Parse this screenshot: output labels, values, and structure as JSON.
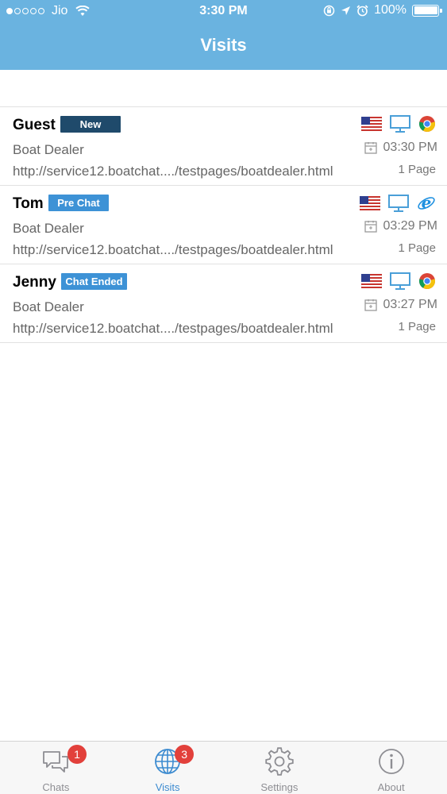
{
  "status_bar": {
    "carrier": "Jio",
    "time": "3:30 PM",
    "battery": "100%"
  },
  "header": {
    "title": "Visits"
  },
  "visits": [
    {
      "name": "Guest",
      "status": "New",
      "status_color": "#1f4a6b",
      "company": "Boat Dealer",
      "url": "http://service12.boatchat..../testpages/boatdealer.html",
      "time": "03:30 PM",
      "pages": "1 Page",
      "browser": "chrome-icon",
      "device": "desktop-icon",
      "flag": "us-flag-icon"
    },
    {
      "name": "Tom",
      "status": "Pre Chat",
      "status_color": "#3d92d6",
      "company": "Boat Dealer",
      "url": "http://service12.boatchat..../testpages/boatdealer.html",
      "time": "03:29 PM",
      "pages": "1 Page",
      "browser": "ie-icon",
      "device": "desktop-icon",
      "flag": "us-flag-icon"
    },
    {
      "name": "Jenny",
      "status": "Chat Ended",
      "status_color": "#3d92d6",
      "company": "Boat Dealer",
      "url": "http://service12.boatchat..../testpages/boatdealer.html",
      "time": "03:27 PM",
      "pages": "1 Page",
      "browser": "chrome-icon",
      "device": "desktop-icon",
      "flag": "us-flag-icon"
    }
  ],
  "tabs": [
    {
      "label": "Chats",
      "badge": "1",
      "icon": "chat-bubbles-icon"
    },
    {
      "label": "Visits",
      "badge": "3",
      "icon": "globe-icon",
      "active": true
    },
    {
      "label": "Settings",
      "icon": "gear-icon"
    },
    {
      "label": "About",
      "icon": "info-icon"
    }
  ],
  "colors": {
    "header_bg": "#6ab3e0",
    "active_tab": "#3c8bd0",
    "badge_red": "#e2403b"
  }
}
